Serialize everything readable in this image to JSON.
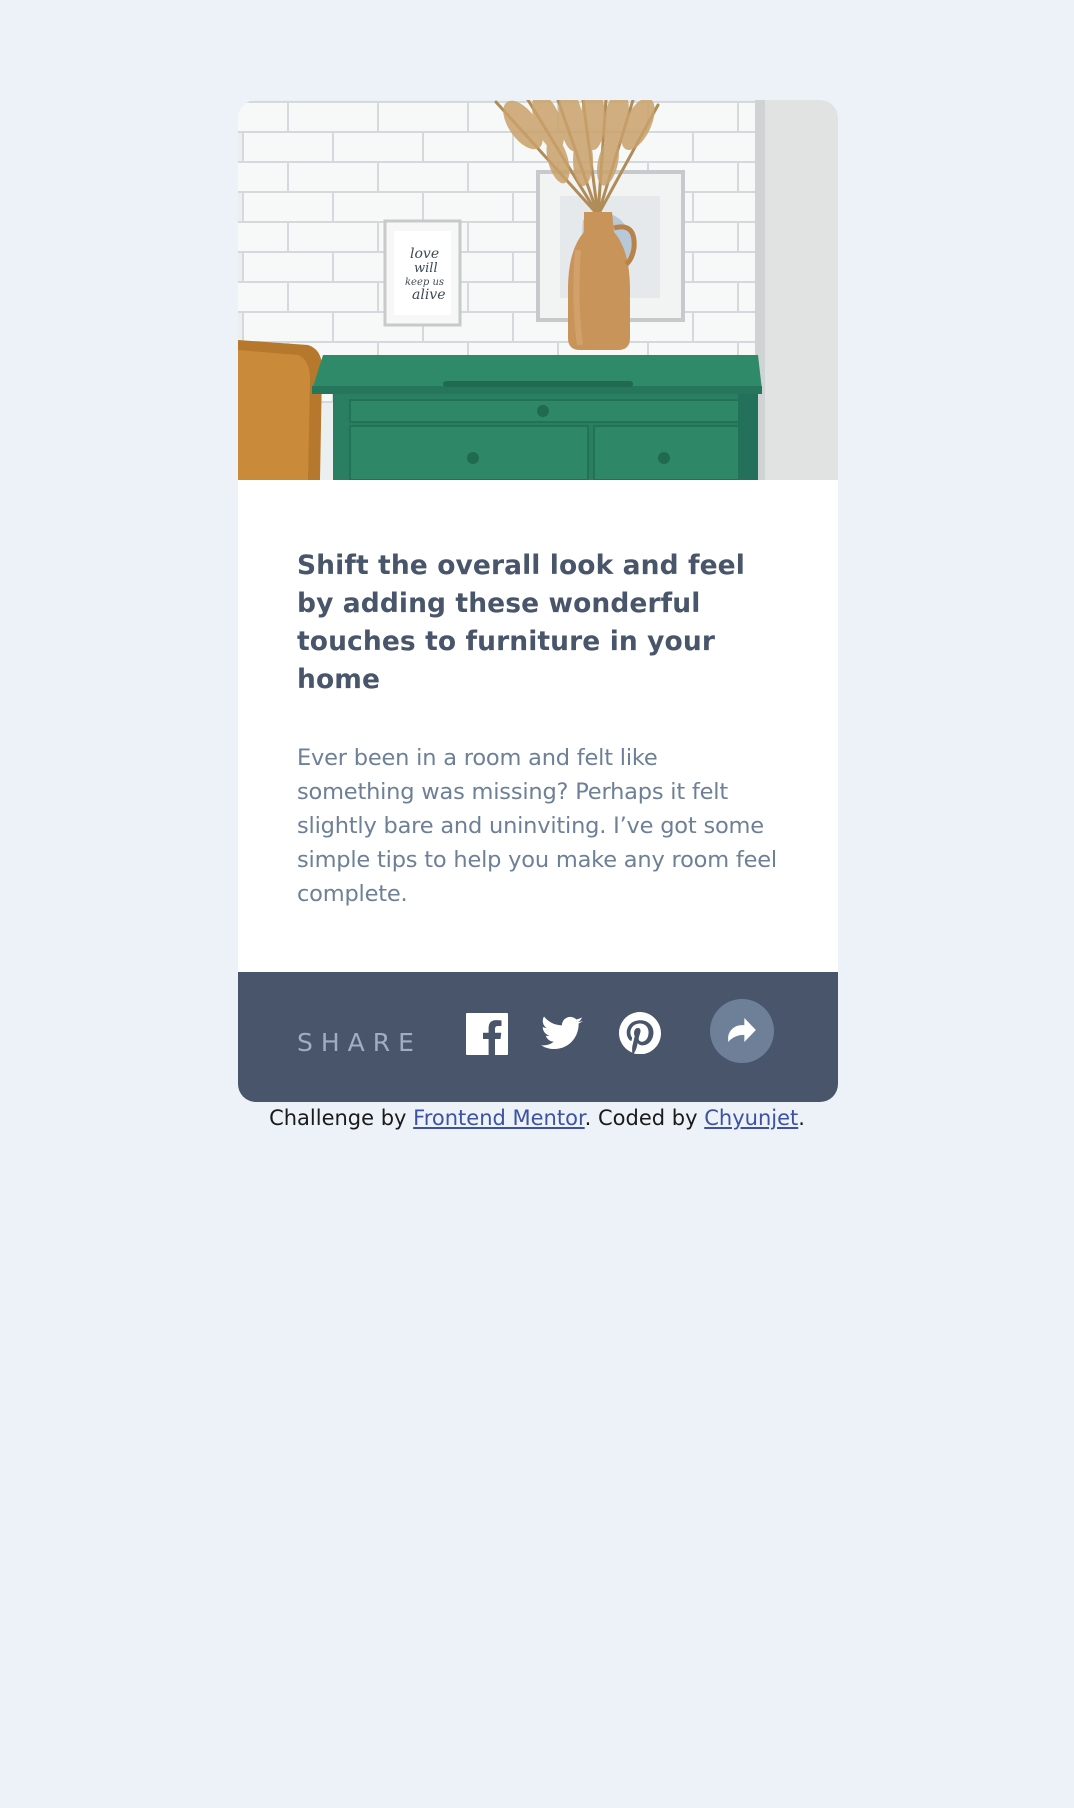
{
  "article": {
    "title": "Shift the overall look and feel by adding these wonderful touches to furniture in your home",
    "description": "Ever been in a room and felt like something was missing? Perhaps it felt slightly bare and uninviting. I’ve got some simple tips to help you make any room feel complete."
  },
  "hero_image": {
    "frame_text": [
      "love",
      "will",
      "keep us",
      "alive"
    ]
  },
  "share_bar": {
    "label": "SHARE",
    "icons": [
      "facebook-icon",
      "twitter-icon",
      "pinterest-icon"
    ],
    "share_button_icon": "share-arrow-icon"
  },
  "attribution": {
    "prefix": "Challenge by ",
    "challenge_link": "Frontend Mentor",
    "middle": ". Coded by ",
    "author_link": "Chyunjet",
    "suffix": "."
  },
  "colors": {
    "page_background": "#ecf2f8",
    "card_background": "#ffffff",
    "title": "#48556a",
    "description": "#6e8098",
    "share_bar": "#48556a",
    "share_label": "#9eafc2",
    "share_button": "#6e8098",
    "link": "#3e52a3"
  }
}
